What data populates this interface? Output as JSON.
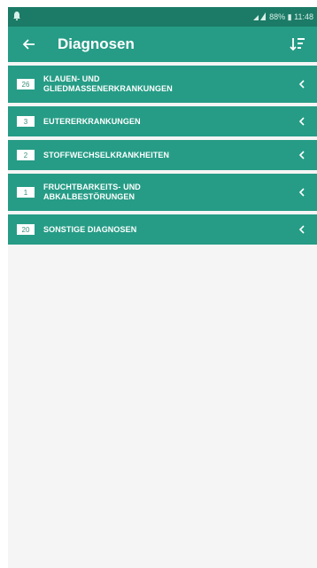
{
  "status_bar": {
    "right_text": "88% ▮ 11:48"
  },
  "toolbar": {
    "title": "Diagnosen"
  },
  "diagnosis_categories": [
    {
      "count": "26",
      "label_line1": "KLAUEN- UND",
      "label_line2": "GLIEDMASSENERKRANKUNGEN"
    },
    {
      "count": "3",
      "label_line1": "EUTERERKRANKUNGEN",
      "label_line2": ""
    },
    {
      "count": "2",
      "label_line1": "STOFFWECHSELKRANKHEITEN",
      "label_line2": ""
    },
    {
      "count": "1",
      "label_line1": "FRUCHTBARKEITS- UND",
      "label_line2": "ABKALBESTÖRUNGEN"
    },
    {
      "count": "20",
      "label_line1": "SONSTIGE DIAGNOSEN",
      "label_line2": ""
    }
  ],
  "colors": {
    "status_bar": "#1b7b66",
    "accent": "#269c86",
    "background": "#f5f5f5"
  }
}
